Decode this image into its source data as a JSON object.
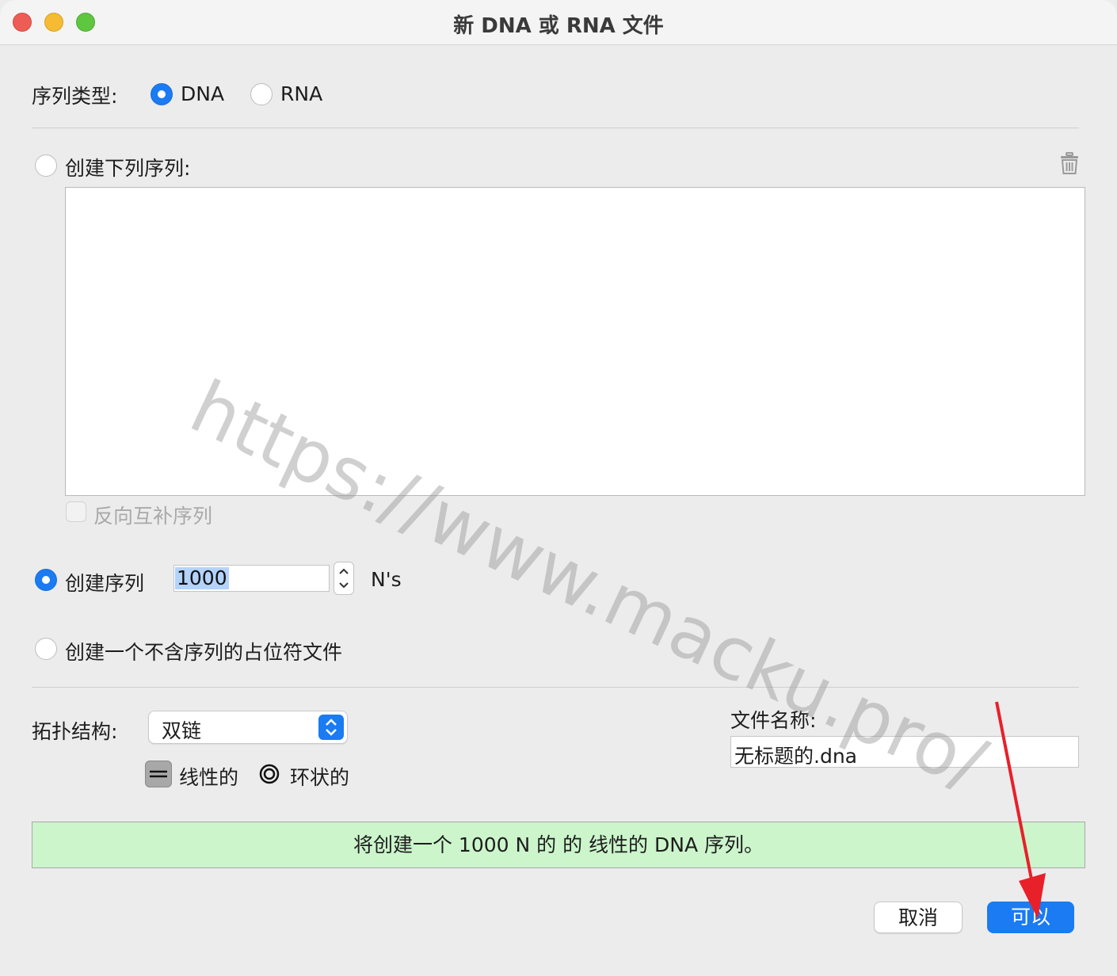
{
  "window": {
    "title": "新 DNA 或 RNA 文件"
  },
  "sequence_type": {
    "label": "序列类型:",
    "options": [
      "DNA",
      "RNA"
    ],
    "selected": "DNA"
  },
  "create_following": {
    "label": "创建下列序列:",
    "text": ""
  },
  "reverse_complement": {
    "label": "反向互补序列",
    "checked": false,
    "enabled": false
  },
  "create_n": {
    "label": "创建序列",
    "value": "1000",
    "unit": "N's",
    "selected": true
  },
  "create_placeholder": {
    "label": "创建一个不含序列的占位符文件"
  },
  "topology": {
    "label": "拓扑结构:",
    "strand_value": "双链",
    "linear_label": "线性的",
    "circular_label": "环状的"
  },
  "filename": {
    "label": "文件名称:",
    "value": "无标题的.dna"
  },
  "status": {
    "text": "将创建一个 1000 N 的 的 线性的 DNA 序列。"
  },
  "buttons": {
    "cancel": "取消",
    "ok": "可以"
  },
  "watermark": "https://www.macku.pro/",
  "colors": {
    "accent": "#1a7bf2",
    "status_bg": "#ccf5cc",
    "annotation_arrow": "#e8202a"
  }
}
